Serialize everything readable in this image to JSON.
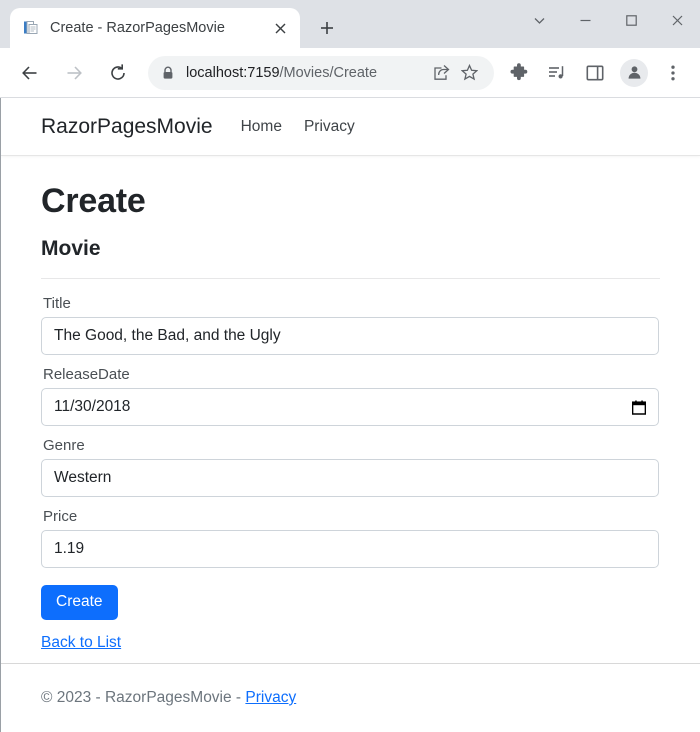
{
  "window": {
    "controls": {
      "tab_search": "tab-search-chevron",
      "minimize": "minimize",
      "maximize": "maximize",
      "close": "close"
    }
  },
  "tabstrip": {
    "active_tab": {
      "title": "Create - RazorPagesMovie",
      "favicon": "document-page-favicon",
      "close_label": "✕"
    },
    "new_tab_label": "+"
  },
  "toolbar": {
    "back_label": "←",
    "forward_label": "→",
    "reload_label": "reload-icon",
    "omnibox": {
      "lock_icon": "lock-icon",
      "host": "localhost:7159",
      "path": "/Movies/Create",
      "full_url": "localhost:7159/Movies/Create",
      "share_icon": "share-icon",
      "bookmark_icon": "star-icon"
    },
    "extensions_icon": "puzzle-piece-icon",
    "media_icon": "media-playlist-icon",
    "side_panel_icon": "side-panel-icon",
    "profile_icon": "person-avatar-icon",
    "menu_icon": "three-dot-menu-icon"
  },
  "site": {
    "navbar": {
      "brand": "RazorPagesMovie",
      "links": [
        {
          "label": "Home"
        },
        {
          "label": "Privacy"
        }
      ]
    },
    "main": {
      "page_title": "Create",
      "section_title": "Movie",
      "fields": [
        {
          "label": "Title",
          "value": "The Good, the Bad, and the Ugly",
          "type": "text",
          "name": "title"
        },
        {
          "label": "ReleaseDate",
          "value": "11/30/2018",
          "type": "date",
          "name": "release-date"
        },
        {
          "label": "Genre",
          "value": "Western",
          "type": "text",
          "name": "genre"
        },
        {
          "label": "Price",
          "value": "1.19",
          "type": "text",
          "name": "price"
        }
      ],
      "submit_label": "Create",
      "back_link_label": "Back to List"
    },
    "footer": {
      "copyright": "© 2023 - RazorPagesMovie - ",
      "privacy_label": "Privacy"
    }
  },
  "colors": {
    "primary": "#0d6efd",
    "tabstrip_bg": "#dee1e6",
    "omnibox_bg": "#f1f3f4",
    "border": "#ced4da",
    "muted_text": "#6c757d"
  }
}
